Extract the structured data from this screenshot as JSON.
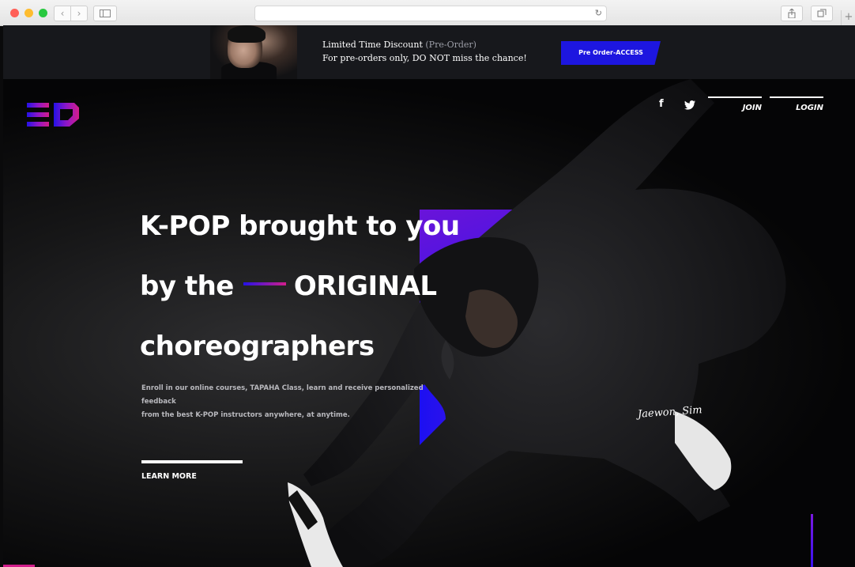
{
  "browser": {
    "url": "",
    "reload_icon": "reload-icon",
    "share_icon": "share-icon",
    "tabs_icon": "tabs-icon",
    "plus": "+"
  },
  "promo": {
    "title": "Limited Time Discount",
    "title_tag": "(Pre-Order)",
    "subtitle": "For pre-orders only, DO NOT miss the chance!",
    "button_label": "Pre Order-ACCESS"
  },
  "header": {
    "join": "JOIN",
    "login": "LOGIN",
    "facebook_icon": "facebook-icon",
    "twitter_icon": "twitter-icon"
  },
  "hero": {
    "title_line1": "K-POP brought to you",
    "title_line2_a": "by the",
    "title_line2_b": "ORIGINAL",
    "title_line3": "choreographers",
    "description_line1": "Enroll in our online courses, TAPAHA Class, learn and receive personalized feedback",
    "description_line2": "from the best K-POP instructors anywhere, at anytime.",
    "cta": "LEARN MORE",
    "signature": "Jaewon, Sim"
  },
  "colors": {
    "accent_blue": "#1d16e0",
    "accent_pink": "#d21d8b",
    "accent_purple": "#6a14d9",
    "background": "#0a0a0b"
  }
}
